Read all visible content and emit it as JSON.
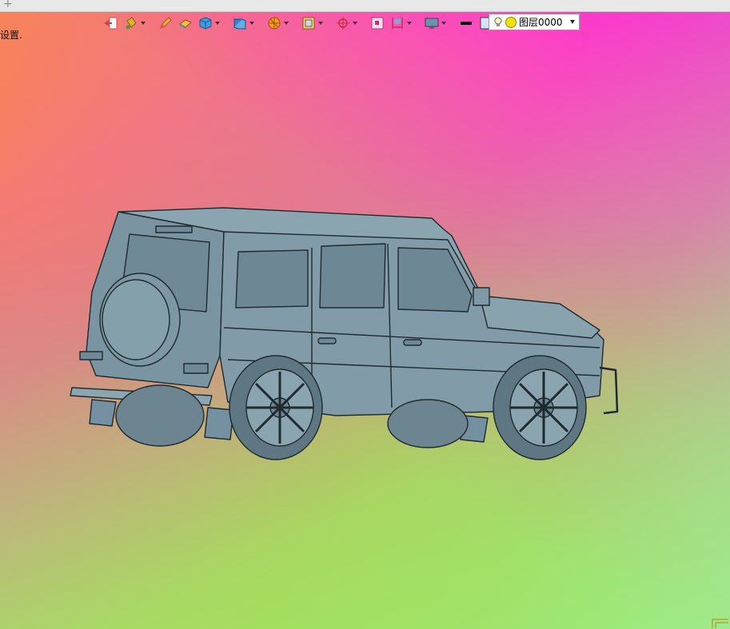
{
  "topstrip": {
    "plus": "+"
  },
  "viewport": {
    "settings_text": "设置."
  },
  "toolbar": {
    "buttons": [
      {
        "name": "exit-icon",
        "has_menu": false
      },
      {
        "name": "paint-bucket-icon",
        "has_menu": true
      },
      {
        "name": "pencil-icon",
        "has_menu": false
      },
      {
        "name": "eraser-icon",
        "has_menu": false
      },
      {
        "name": "cube-icon",
        "has_menu": true
      },
      {
        "name": "view-cube-icon",
        "has_menu": true
      },
      {
        "name": "render-sphere-icon",
        "has_menu": true
      },
      {
        "name": "display-frame-icon",
        "has_menu": true
      },
      {
        "name": "snap-target-icon",
        "has_menu": true
      },
      {
        "name": "select-box-icon",
        "has_menu": false
      },
      {
        "name": "dimension-icon",
        "has_menu": true
      },
      {
        "name": "monitor-icon",
        "has_menu": true
      },
      {
        "name": "line-weight-icon",
        "has_menu": false
      },
      {
        "name": "color-swatch-icon",
        "has_menu": false
      },
      {
        "name": "layers-icon",
        "has_menu": true
      }
    ]
  },
  "layer_dropdown": {
    "value": "图层0000"
  },
  "colors": {
    "car_body": "#7f9aa6",
    "car_outline": "#1e2a30",
    "background_top_left": "#ff8a3a",
    "background_top_right": "#ff28d8",
    "background_bottom_left": "#86f02a",
    "background_bottom_right": "#a8e890"
  }
}
